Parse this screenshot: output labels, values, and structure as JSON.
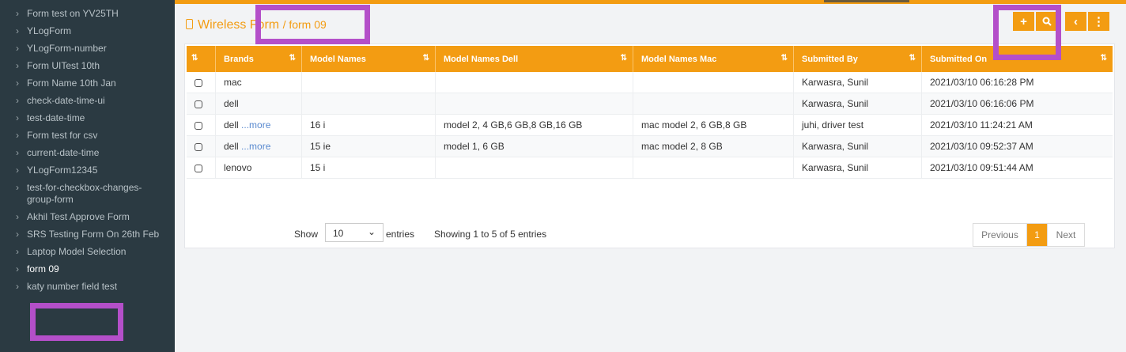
{
  "colors": {
    "accent": "#f39c12",
    "sidebar_bg": "#2b3a42",
    "highlight": "#b44fc9"
  },
  "sidebar": {
    "items": [
      {
        "label": "Form test on YV25TH"
      },
      {
        "label": "YLogForm"
      },
      {
        "label": "YLogForm-number"
      },
      {
        "label": "Form UITest 10th"
      },
      {
        "label": "Form Name 10th Jan"
      },
      {
        "label": "check-date-time-ui"
      },
      {
        "label": "test-date-time"
      },
      {
        "label": "Form test for csv"
      },
      {
        "label": "current-date-time"
      },
      {
        "label": "YLogForm12345"
      },
      {
        "label": "test-for-checkbox-changes-group-form"
      },
      {
        "label": "Akhil Test Approve Form"
      },
      {
        "label": "SRS Testing Form On 26th Feb"
      },
      {
        "label": "Laptop Model Selection"
      },
      {
        "label": "form 09"
      },
      {
        "label": "katy number field test"
      }
    ]
  },
  "header": {
    "title": "Wireless Form",
    "breadcrumb": "/ form 09",
    "icons": [
      "mobile-icon"
    ]
  },
  "toolbar": {
    "add_label": "+",
    "search_icon": "search-icon",
    "back_label": "‹",
    "more_label": "⋮"
  },
  "table": {
    "sort_glyph": "⇅",
    "columns": [
      "Brands",
      "Model Names",
      "Model Names Dell",
      "Model Names Mac",
      "Submitted By",
      "Submitted On"
    ],
    "more_label": "...more",
    "rows": [
      {
        "brand": "mac",
        "brand_more": "",
        "model": "",
        "dell": "",
        "mac": "",
        "by": "Karwasra, Sunil",
        "on": "2021/03/10 06:16:28 PM"
      },
      {
        "brand": "dell",
        "brand_more": "",
        "model": "",
        "dell": "",
        "mac": "",
        "by": "Karwasra, Sunil",
        "on": "2021/03/10 06:16:06 PM"
      },
      {
        "brand": "dell",
        "brand_more": "...more",
        "model": "16 i",
        "dell": "model 2, 4 GB,6 GB,8 GB,16 GB",
        "mac": "mac model 2, 6 GB,8 GB",
        "by": "juhi, driver test",
        "on": "2021/03/10 11:24:21 AM"
      },
      {
        "brand": "dell",
        "brand_more": "...more",
        "model": "15 ie",
        "dell": "model 1, 6 GB",
        "mac": "mac model 2, 8 GB",
        "by": "Karwasra, Sunil",
        "on": "2021/03/10 09:52:37 AM"
      },
      {
        "brand": "lenovo",
        "brand_more": "",
        "model": "15 i",
        "dell": "",
        "mac": "",
        "by": "Karwasra, Sunil",
        "on": "2021/03/10 09:51:44 AM"
      }
    ]
  },
  "footer": {
    "show_label": "Show",
    "page_length": "10",
    "entries_label": "entries",
    "info": "Showing 1 to 5 of 5 entries",
    "prev_label": "Previous",
    "current_page": "1",
    "next_label": "Next"
  }
}
